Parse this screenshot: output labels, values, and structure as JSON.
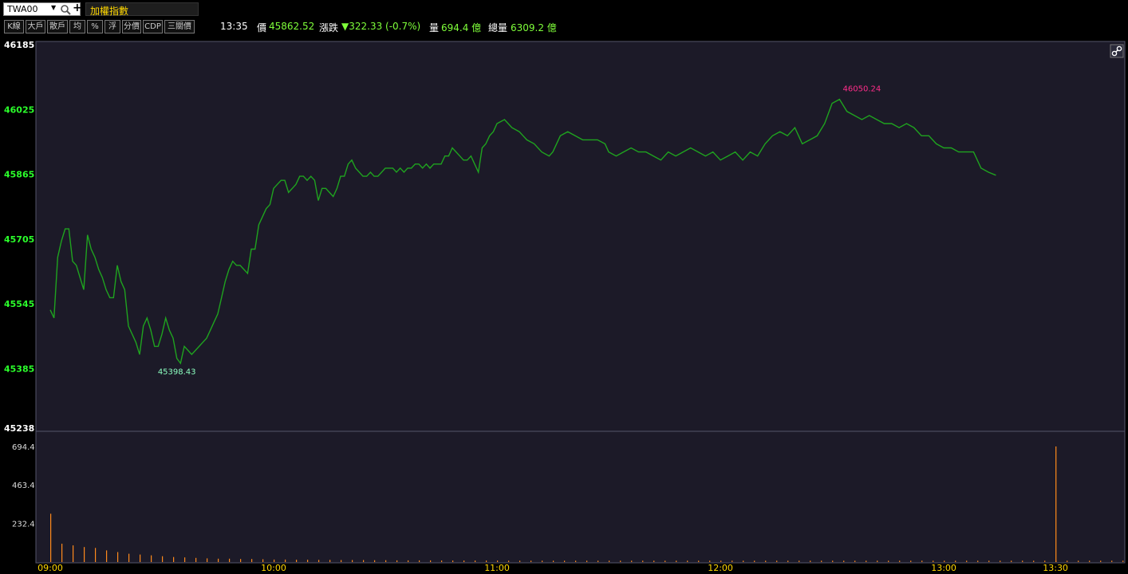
{
  "header": {
    "symbol": "TWA00",
    "index_name": "加權指數"
  },
  "toolbar": {
    "buttons": [
      "K線",
      "大戶",
      "散戶",
      "均",
      "%",
      "浮",
      "分價",
      "CDP",
      "三關價"
    ]
  },
  "quote": {
    "time": "13:35",
    "price_label": "價",
    "price": "45862.52",
    "change_label": "漲跌",
    "change": "▼322.33 (-0.7%)",
    "volume_label": "量",
    "volume": "694.4 億",
    "total_volume_label": "總量",
    "total_volume": "6309.2 億"
  },
  "colors": {
    "background": "#1c1a28",
    "price_line": "#1fa31f",
    "axis_green": "#2bff2b",
    "volume_bar": "#ff8a1c",
    "high_label": "#ff2d8a",
    "low_label": "#8cffc0",
    "time_label": "#ffd700"
  },
  "chart_data": {
    "type": "line",
    "title": "加權指數",
    "price_axis": {
      "ticks": [
        46185,
        46025,
        45865,
        45705,
        45545,
        45385,
        45238
      ],
      "ylim": [
        45238,
        46185
      ]
    },
    "volume_axis": {
      "ticks": [
        "694.4",
        "463.4",
        "232.4"
      ],
      "ylim": [
        0,
        694.4
      ]
    },
    "x_ticks": [
      "09:00",
      "10:00",
      "11:00",
      "12:00",
      "13:00",
      "13:30"
    ],
    "high": {
      "label": "46050.24",
      "time": "12:38"
    },
    "low": {
      "label": "45398.43",
      "time": "09:34"
    },
    "price_series": {
      "name": "加權指數",
      "x": [
        "09:00",
        "09:01",
        "09:02",
        "09:03",
        "09:04",
        "09:05",
        "09:06",
        "09:07",
        "09:08",
        "09:09",
        "09:10",
        "09:11",
        "09:12",
        "09:13",
        "09:14",
        "09:15",
        "09:16",
        "09:17",
        "09:18",
        "09:19",
        "09:20",
        "09:21",
        "09:22",
        "09:23",
        "09:24",
        "09:25",
        "09:26",
        "09:27",
        "09:28",
        "09:29",
        "09:30",
        "09:31",
        "09:32",
        "09:33",
        "09:34",
        "09:35",
        "09:36",
        "09:37",
        "09:38",
        "09:39",
        "09:40",
        "09:41",
        "09:42",
        "09:43",
        "09:44",
        "09:45",
        "09:46",
        "09:47",
        "09:48",
        "09:49",
        "09:50",
        "09:51",
        "09:52",
        "09:53",
        "09:54",
        "09:55",
        "09:56",
        "09:57",
        "09:58",
        "09:59",
        "10:00",
        "10:01",
        "10:02",
        "10:03",
        "10:04",
        "10:05",
        "10:06",
        "10:07",
        "10:08",
        "10:09",
        "10:10",
        "10:11",
        "10:12",
        "10:13",
        "10:14",
        "10:15",
        "10:16",
        "10:17",
        "10:18",
        "10:19",
        "10:20",
        "10:21",
        "10:22",
        "10:23",
        "10:24",
        "10:25",
        "10:26",
        "10:27",
        "10:28",
        "10:29",
        "10:30",
        "10:31",
        "10:32",
        "10:33",
        "10:34",
        "10:35",
        "10:36",
        "10:37",
        "10:38",
        "10:39",
        "10:40",
        "10:41",
        "10:42",
        "10:43",
        "10:44",
        "10:45",
        "10:46",
        "10:47",
        "10:48",
        "10:49",
        "10:50",
        "10:51",
        "10:52",
        "10:53",
        "10:54",
        "10:55",
        "10:56",
        "10:57",
        "10:58",
        "10:59",
        "11:00",
        "11:02",
        "11:04",
        "11:06",
        "11:07",
        "11:08",
        "11:10",
        "11:12",
        "11:14",
        "11:15",
        "11:17",
        "11:19",
        "11:21",
        "11:23",
        "11:25",
        "11:27",
        "11:29",
        "11:30",
        "11:32",
        "11:34",
        "11:36",
        "11:38",
        "11:40",
        "11:42",
        "11:44",
        "11:46",
        "11:48",
        "11:50",
        "11:52",
        "11:54",
        "11:56",
        "11:58",
        "12:00",
        "12:02",
        "12:04",
        "12:06",
        "12:08",
        "12:10",
        "12:12",
        "12:14",
        "12:16",
        "12:18",
        "12:20",
        "12:22",
        "12:24",
        "12:26",
        "12:28",
        "12:30",
        "12:32",
        "12:34",
        "12:36",
        "12:38",
        "12:40",
        "12:42",
        "12:44",
        "12:46",
        "12:48",
        "12:50",
        "12:52",
        "12:54",
        "12:56",
        "12:58",
        "13:00",
        "13:02",
        "13:04",
        "13:06",
        "13:08",
        "13:10",
        "13:12",
        "13:14",
        "13:16",
        "13:18",
        "13:20",
        "13:22",
        "13:24",
        "13:25",
        "13:35"
      ],
      "values": [
        45530,
        45510,
        45660,
        45700,
        45730,
        45730,
        45650,
        45640,
        45610,
        45580,
        45715,
        45680,
        45660,
        45630,
        45610,
        45580,
        45560,
        45560,
        45640,
        45600,
        45580,
        45490,
        45470,
        45450,
        45420,
        45490,
        45510,
        45480,
        45440,
        45440,
        45470,
        45510,
        45480,
        45460,
        45410,
        45398,
        45440,
        45430,
        45420,
        45430,
        45440,
        45450,
        45460,
        45480,
        45500,
        45520,
        45560,
        45600,
        45630,
        45650,
        45640,
        45640,
        45630,
        45620,
        45680,
        45680,
        45740,
        45760,
        45780,
        45790,
        45830,
        45840,
        45850,
        45850,
        45820,
        45830,
        45840,
        45860,
        45860,
        45850,
        45860,
        45850,
        45800,
        45830,
        45830,
        45820,
        45810,
        45830,
        45860,
        45860,
        45890,
        45900,
        45880,
        45870,
        45860,
        45860,
        45870,
        45860,
        45860,
        45870,
        45880,
        45880,
        45880,
        45870,
        45880,
        45870,
        45880,
        45880,
        45890,
        45890,
        45880,
        45890,
        45880,
        45890,
        45890,
        45890,
        45910,
        45910,
        45930,
        45920,
        45910,
        45900,
        45900,
        45910,
        45890,
        45870,
        45930,
        45940,
        45960,
        45970,
        45990,
        46000,
        45980,
        45970,
        45960,
        45950,
        45940,
        45920,
        45910,
        45920,
        45960,
        45970,
        45960,
        45950,
        45950,
        45950,
        45940,
        45920,
        45910,
        45920,
        45930,
        45920,
        45920,
        45910,
        45900,
        45920,
        45910,
        45920,
        45930,
        45920,
        45910,
        45920,
        45900,
        45910,
        45920,
        45900,
        45920,
        45910,
        45940,
        45960,
        45970,
        45960,
        45980,
        45940,
        45950,
        45960,
        45990,
        46040,
        46050,
        46020,
        46010,
        46000,
        46010,
        46000,
        45990,
        45990,
        45980,
        45990,
        45980,
        45960,
        45960,
        45940,
        45930,
        45930,
        45920,
        45920,
        45920,
        45880,
        45870,
        45862.52
      ]
    },
    "volume_series": {
      "name": "量",
      "values": [
        290,
        110,
        100,
        90,
        85,
        70,
        60,
        50,
        45,
        40,
        35,
        30,
        28,
        25,
        22,
        20,
        20,
        18,
        18,
        17,
        15,
        15,
        14,
        14,
        13,
        13,
        12,
        12,
        12,
        11,
        11,
        10,
        10,
        10,
        10,
        9,
        9,
        9,
        9,
        9,
        9,
        8,
        8,
        8,
        8,
        8,
        8,
        8,
        8,
        8,
        8,
        8,
        8,
        8,
        8,
        8,
        8,
        8,
        8,
        8,
        8,
        8,
        8,
        8,
        8,
        8,
        8,
        8,
        8,
        8,
        8,
        8,
        8,
        8,
        8,
        8,
        8,
        8,
        8,
        8,
        8,
        8,
        8,
        8,
        8,
        8,
        8,
        8,
        8,
        8,
        8,
        8,
        8,
        8,
        8,
        8,
        8,
        8,
        8,
        8,
        694.4
      ]
    }
  }
}
